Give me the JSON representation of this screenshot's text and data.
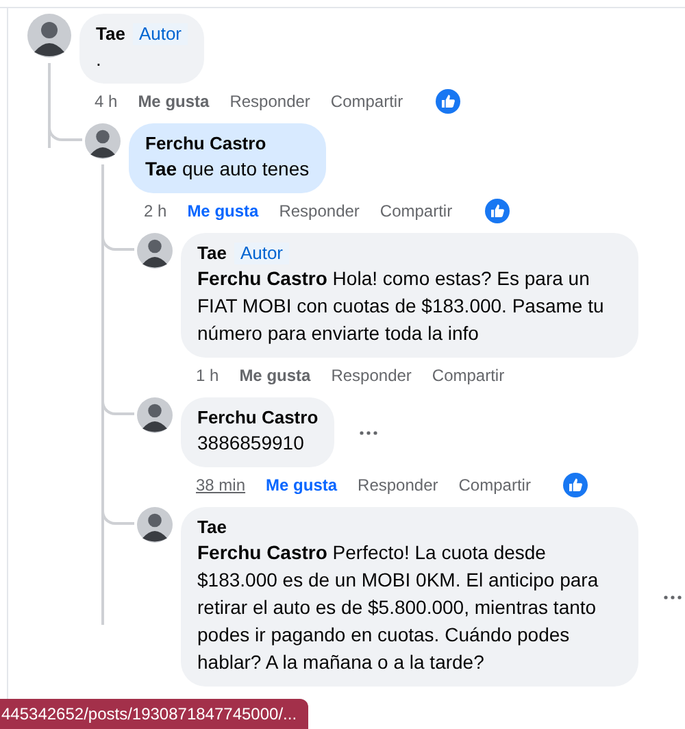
{
  "comments": [
    {
      "author": "Tae",
      "badge": "Autor",
      "text": ".",
      "highlighted": false,
      "time": "4 h",
      "time_underlined": false,
      "like_label": "Me gusta",
      "liked": false,
      "reply_label": "Responder",
      "share_label": "Compartir",
      "reaction": true,
      "more_icon": false,
      "children": [
        {
          "author": "Ferchu Castro",
          "mention": "Tae",
          "text": " que auto tenes",
          "highlighted": true,
          "time": "2 h",
          "time_underlined": false,
          "like_label": "Me gusta",
          "liked": true,
          "reply_label": "Responder",
          "share_label": "Compartir",
          "reaction": true,
          "more_icon": false,
          "children": [
            {
              "author": "Tae",
              "badge": "Autor",
              "mention": "Ferchu Castro",
              "text": " Hola! como estas? Es para un FIAT MOBI con cuotas de $183.000. Pasame tu número para enviarte toda la info",
              "highlighted": false,
              "time": "1 h",
              "time_underlined": false,
              "like_label": "Me gusta",
              "liked": false,
              "reply_label": "Responder",
              "share_label": "Compartir",
              "reaction": false,
              "more_icon": false
            },
            {
              "author": "Ferchu Castro",
              "text": "3886859910",
              "highlighted": false,
              "time": "38 min",
              "time_underlined": true,
              "like_label": "Me gusta",
              "liked": true,
              "reply_label": "Responder",
              "share_label": "Compartir",
              "reaction": true,
              "more_icon": true
            },
            {
              "author": "Tae",
              "mention": "Ferchu Castro",
              "text": " Perfecto! La cuota desde $183.000 es de un MOBI 0KM. El anticipo para retirar el auto es de $5.800.000, mientras tanto podes ir pagando en cuotas. Cuándo podes hablar? A la mañana o a la tarde?",
              "highlighted": false,
              "more_icon": true
            }
          ]
        }
      ]
    }
  ],
  "status_url": "445342652/posts/1930871847745000/..."
}
